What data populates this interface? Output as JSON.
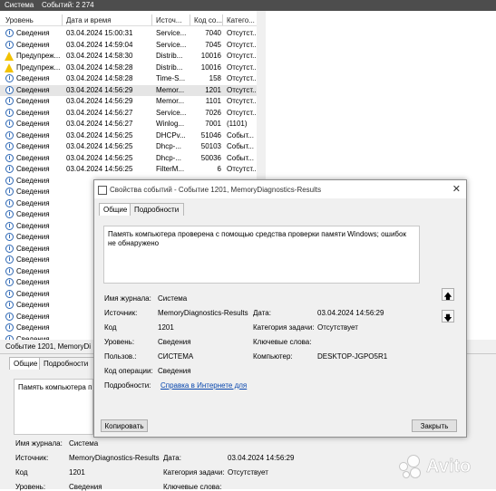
{
  "topbar": {
    "title": "Система",
    "count": "Событий: 2 274"
  },
  "columns": [
    "Уровень",
    "Дата и время",
    "Источ...",
    "Код со...",
    "Катего..."
  ],
  "rows": [
    {
      "level": "Сведения",
      "icon": "info",
      "date": "03.04.2024 15:00:31",
      "source": "Service...",
      "code": "7040",
      "cat": "Отсутст..."
    },
    {
      "level": "Сведения",
      "icon": "info",
      "date": "03.04.2024 14:59:04",
      "source": "Service...",
      "code": "7045",
      "cat": "Отсутст..."
    },
    {
      "level": "Предупреж...",
      "icon": "warning",
      "date": "03.04.2024 14:58:30",
      "source": "Distrib...",
      "code": "10016",
      "cat": "Отсутст..."
    },
    {
      "level": "Предупреж...",
      "icon": "warning",
      "date": "03.04.2024 14:58:28",
      "source": "Distrib...",
      "code": "10016",
      "cat": "Отсутст..."
    },
    {
      "level": "Сведения",
      "icon": "info",
      "date": "03.04.2024 14:58:28",
      "source": "Time-S...",
      "code": "158",
      "cat": "Отсутст..."
    },
    {
      "level": "Сведения",
      "icon": "info",
      "date": "03.04.2024 14:56:29",
      "source": "Memor...",
      "code": "1201",
      "cat": "Отсутст...",
      "selected": true
    },
    {
      "level": "Сведения",
      "icon": "info",
      "date": "03.04.2024 14:56:29",
      "source": "Memor...",
      "code": "1101",
      "cat": "Отсутст..."
    },
    {
      "level": "Сведения",
      "icon": "info",
      "date": "03.04.2024 14:56:27",
      "source": "Service...",
      "code": "7026",
      "cat": "Отсутст..."
    },
    {
      "level": "Сведения",
      "icon": "info",
      "date": "03.04.2024 14:56:27",
      "source": "Winlog...",
      "code": "7001",
      "cat": "(1101)"
    },
    {
      "level": "Сведения",
      "icon": "info",
      "date": "03.04.2024 14:56:25",
      "source": "DHCPv...",
      "code": "51046",
      "cat": "Событ..."
    },
    {
      "level": "Сведения",
      "icon": "info",
      "date": "03.04.2024 14:56:25",
      "source": "Dhcp-...",
      "code": "50103",
      "cat": "Событ..."
    },
    {
      "level": "Сведения",
      "icon": "info",
      "date": "03.04.2024 14:56:25",
      "source": "Dhcp-...",
      "code": "50036",
      "cat": "Событ..."
    },
    {
      "level": "Сведения",
      "icon": "info",
      "date": "03.04.2024 14:56:25",
      "source": "FilterM...",
      "code": "6",
      "cat": "Отсутст..."
    },
    {
      "level": "Сведения",
      "icon": "info",
      "date": "",
      "source": "",
      "code": "",
      "cat": ""
    },
    {
      "level": "Сведения",
      "icon": "info",
      "date": "",
      "source": "",
      "code": "",
      "cat": ""
    },
    {
      "level": "Сведения",
      "icon": "info",
      "date": "",
      "source": "",
      "code": "",
      "cat": ""
    },
    {
      "level": "Сведения",
      "icon": "info",
      "date": "",
      "source": "",
      "code": "",
      "cat": ""
    },
    {
      "level": "Сведения",
      "icon": "info",
      "date": "",
      "source": "",
      "code": "",
      "cat": ""
    },
    {
      "level": "Сведения",
      "icon": "info",
      "date": "",
      "source": "",
      "code": "",
      "cat": ""
    },
    {
      "level": "Сведения",
      "icon": "info",
      "date": "",
      "source": "",
      "code": "",
      "cat": ""
    },
    {
      "level": "Сведения",
      "icon": "info",
      "date": "",
      "source": "",
      "code": "",
      "cat": ""
    },
    {
      "level": "Сведения",
      "icon": "info",
      "date": "",
      "source": "",
      "code": "",
      "cat": ""
    },
    {
      "level": "Сведения",
      "icon": "info",
      "date": "",
      "source": "",
      "code": "",
      "cat": ""
    },
    {
      "level": "Сведения",
      "icon": "info",
      "date": "",
      "source": "",
      "code": "",
      "cat": ""
    },
    {
      "level": "Сведения",
      "icon": "info",
      "date": "",
      "source": "",
      "code": "",
      "cat": ""
    },
    {
      "level": "Сведения",
      "icon": "info",
      "date": "",
      "source": "",
      "code": "",
      "cat": ""
    },
    {
      "level": "Сведения",
      "icon": "info",
      "date": "",
      "source": "",
      "code": "",
      "cat": ""
    },
    {
      "level": "Сведения",
      "icon": "info",
      "date": "",
      "source": "",
      "code": "",
      "cat": ""
    }
  ],
  "bottom": {
    "title": "Событие 1201, MemoryDi",
    "tab_general": "Общие",
    "tab_details": "Подробности",
    "message": "Память компьютера п",
    "labels": {
      "log": "Имя журнала:",
      "source": "Источник:",
      "code": "Код",
      "level": "Уровень:",
      "date": "Дата:",
      "task": "Категория задачи:",
      "keywords": "Ключевые слова:"
    },
    "values": {
      "log": "Система",
      "source": "MemoryDiagnostics-Results",
      "code": "1201",
      "level": "Сведения",
      "date": "03.04.2024 14:56:29",
      "task": "Отсутствует"
    }
  },
  "dialog": {
    "title": "Свойства событий - Событие 1201, MemoryDiagnostics-Results",
    "tab_general": "Общие",
    "tab_details": "Подробности",
    "message": "Память компьютера проверена с помощью средства проверки памяти Windows; ошибок не обнаружено",
    "labels": {
      "log": "Имя журнала:",
      "source": "Источник:",
      "code": "Код",
      "level": "Уровень:",
      "user": "Пользов.:",
      "opcode": "Код операции:",
      "details": "Подробности:",
      "date": "Дата:",
      "task": "Категория задачи:",
      "keywords": "Ключевые слова:",
      "computer": "Компьютер:"
    },
    "values": {
      "log": "Система",
      "source": "MemoryDiagnostics-Results",
      "code": "1201",
      "level": "Сведения",
      "user": "СИСТЕМА",
      "opcode": "Сведения",
      "details_link": "Справка в Интернете для",
      "date": "03.04.2024 14:56:29",
      "task": "Отсутствует",
      "keywords": "",
      "computer": "DESKTOP-JGPO5R1"
    },
    "copy_button": "Копировать",
    "close_button": "Закрыть",
    "close_glyph": "✕",
    "up_glyph": "🡅",
    "down_glyph": "🡇"
  },
  "watermark": {
    "text": "Avito"
  }
}
